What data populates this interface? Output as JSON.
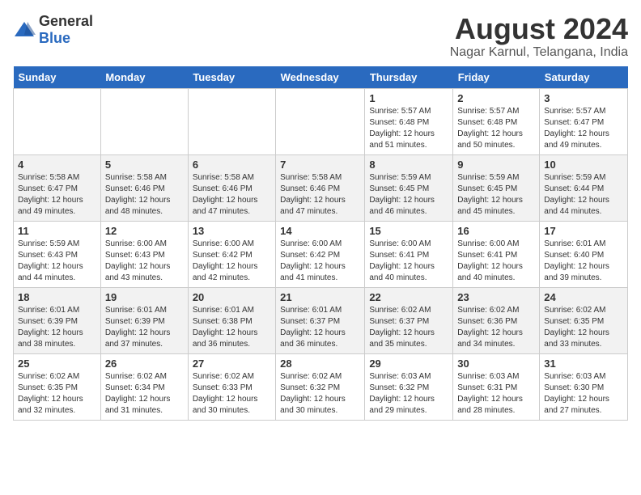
{
  "logo": {
    "general": "General",
    "blue": "Blue"
  },
  "title": "August 2024",
  "subtitle": "Nagar Karnul, Telangana, India",
  "days_of_week": [
    "Sunday",
    "Monday",
    "Tuesday",
    "Wednesday",
    "Thursday",
    "Friday",
    "Saturday"
  ],
  "weeks": [
    [
      {
        "day": "",
        "info": ""
      },
      {
        "day": "",
        "info": ""
      },
      {
        "day": "",
        "info": ""
      },
      {
        "day": "",
        "info": ""
      },
      {
        "day": "1",
        "info": "Sunrise: 5:57 AM\nSunset: 6:48 PM\nDaylight: 12 hours and 51 minutes."
      },
      {
        "day": "2",
        "info": "Sunrise: 5:57 AM\nSunset: 6:48 PM\nDaylight: 12 hours and 50 minutes."
      },
      {
        "day": "3",
        "info": "Sunrise: 5:57 AM\nSunset: 6:47 PM\nDaylight: 12 hours and 49 minutes."
      }
    ],
    [
      {
        "day": "4",
        "info": "Sunrise: 5:58 AM\nSunset: 6:47 PM\nDaylight: 12 hours and 49 minutes."
      },
      {
        "day": "5",
        "info": "Sunrise: 5:58 AM\nSunset: 6:46 PM\nDaylight: 12 hours and 48 minutes."
      },
      {
        "day": "6",
        "info": "Sunrise: 5:58 AM\nSunset: 6:46 PM\nDaylight: 12 hours and 47 minutes."
      },
      {
        "day": "7",
        "info": "Sunrise: 5:58 AM\nSunset: 6:46 PM\nDaylight: 12 hours and 47 minutes."
      },
      {
        "day": "8",
        "info": "Sunrise: 5:59 AM\nSunset: 6:45 PM\nDaylight: 12 hours and 46 minutes."
      },
      {
        "day": "9",
        "info": "Sunrise: 5:59 AM\nSunset: 6:45 PM\nDaylight: 12 hours and 45 minutes."
      },
      {
        "day": "10",
        "info": "Sunrise: 5:59 AM\nSunset: 6:44 PM\nDaylight: 12 hours and 44 minutes."
      }
    ],
    [
      {
        "day": "11",
        "info": "Sunrise: 5:59 AM\nSunset: 6:43 PM\nDaylight: 12 hours and 44 minutes."
      },
      {
        "day": "12",
        "info": "Sunrise: 6:00 AM\nSunset: 6:43 PM\nDaylight: 12 hours and 43 minutes."
      },
      {
        "day": "13",
        "info": "Sunrise: 6:00 AM\nSunset: 6:42 PM\nDaylight: 12 hours and 42 minutes."
      },
      {
        "day": "14",
        "info": "Sunrise: 6:00 AM\nSunset: 6:42 PM\nDaylight: 12 hours and 41 minutes."
      },
      {
        "day": "15",
        "info": "Sunrise: 6:00 AM\nSunset: 6:41 PM\nDaylight: 12 hours and 40 minutes."
      },
      {
        "day": "16",
        "info": "Sunrise: 6:00 AM\nSunset: 6:41 PM\nDaylight: 12 hours and 40 minutes."
      },
      {
        "day": "17",
        "info": "Sunrise: 6:01 AM\nSunset: 6:40 PM\nDaylight: 12 hours and 39 minutes."
      }
    ],
    [
      {
        "day": "18",
        "info": "Sunrise: 6:01 AM\nSunset: 6:39 PM\nDaylight: 12 hours and 38 minutes."
      },
      {
        "day": "19",
        "info": "Sunrise: 6:01 AM\nSunset: 6:39 PM\nDaylight: 12 hours and 37 minutes."
      },
      {
        "day": "20",
        "info": "Sunrise: 6:01 AM\nSunset: 6:38 PM\nDaylight: 12 hours and 36 minutes."
      },
      {
        "day": "21",
        "info": "Sunrise: 6:01 AM\nSunset: 6:37 PM\nDaylight: 12 hours and 36 minutes."
      },
      {
        "day": "22",
        "info": "Sunrise: 6:02 AM\nSunset: 6:37 PM\nDaylight: 12 hours and 35 minutes."
      },
      {
        "day": "23",
        "info": "Sunrise: 6:02 AM\nSunset: 6:36 PM\nDaylight: 12 hours and 34 minutes."
      },
      {
        "day": "24",
        "info": "Sunrise: 6:02 AM\nSunset: 6:35 PM\nDaylight: 12 hours and 33 minutes."
      }
    ],
    [
      {
        "day": "25",
        "info": "Sunrise: 6:02 AM\nSunset: 6:35 PM\nDaylight: 12 hours and 32 minutes."
      },
      {
        "day": "26",
        "info": "Sunrise: 6:02 AM\nSunset: 6:34 PM\nDaylight: 12 hours and 31 minutes."
      },
      {
        "day": "27",
        "info": "Sunrise: 6:02 AM\nSunset: 6:33 PM\nDaylight: 12 hours and 30 minutes."
      },
      {
        "day": "28",
        "info": "Sunrise: 6:02 AM\nSunset: 6:32 PM\nDaylight: 12 hours and 30 minutes."
      },
      {
        "day": "29",
        "info": "Sunrise: 6:03 AM\nSunset: 6:32 PM\nDaylight: 12 hours and 29 minutes."
      },
      {
        "day": "30",
        "info": "Sunrise: 6:03 AM\nSunset: 6:31 PM\nDaylight: 12 hours and 28 minutes."
      },
      {
        "day": "31",
        "info": "Sunrise: 6:03 AM\nSunset: 6:30 PM\nDaylight: 12 hours and 27 minutes."
      }
    ]
  ]
}
